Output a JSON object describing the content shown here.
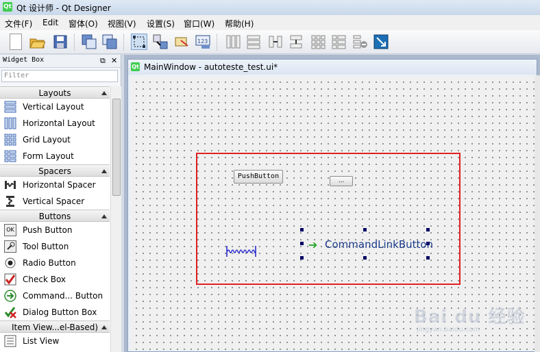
{
  "window": {
    "title": "Qt 设计师 - Qt Designer",
    "logo": "Qt"
  },
  "menu": [
    {
      "label": "文件(F)"
    },
    {
      "label": "Edit"
    },
    {
      "label": "窗体(O)"
    },
    {
      "label": "视图(V)"
    },
    {
      "label": "设置(S)"
    },
    {
      "label": "窗口(W)"
    },
    {
      "label": "帮助(H)"
    }
  ],
  "toolbar": {
    "icons": [
      "new-file-icon",
      "open-folder-icon",
      "save-icon",
      "send-to-back-icon",
      "bring-to-front-icon",
      "edit-widgets-icon",
      "edit-signals-slots-icon",
      "edit-buddies-icon",
      "edit-tab-order-icon",
      "lay-out-horizontally-icon",
      "lay-out-vertically-icon",
      "lay-out-horizontally-splitter-icon",
      "lay-out-vertically-splitter-icon",
      "lay-out-grid-icon",
      "lay-out-form-icon",
      "break-layout-icon",
      "adjust-size-icon"
    ]
  },
  "widget_box": {
    "title": "Widget Box",
    "filter_placeholder": "Filter",
    "categories": [
      {
        "label": "Layouts",
        "items": [
          {
            "label": "Vertical Layout",
            "icon": "vertical-layout-icon"
          },
          {
            "label": "Horizontal Layout",
            "icon": "horizontal-layout-icon"
          },
          {
            "label": "Grid Layout",
            "icon": "grid-layout-icon"
          },
          {
            "label": "Form Layout",
            "icon": "form-layout-icon"
          }
        ]
      },
      {
        "label": "Spacers",
        "items": [
          {
            "label": "Horizontal Spacer",
            "icon": "horizontal-spacer-icon"
          },
          {
            "label": "Vertical Spacer",
            "icon": "vertical-spacer-icon"
          }
        ]
      },
      {
        "label": "Buttons",
        "items": [
          {
            "label": "Push Button",
            "icon": "push-button-icon"
          },
          {
            "label": "Tool Button",
            "icon": "tool-button-icon"
          },
          {
            "label": "Radio Button",
            "icon": "radio-button-icon"
          },
          {
            "label": "Check Box",
            "icon": "check-box-icon"
          },
          {
            "label": "Command... Button",
            "icon": "command-link-button-icon"
          },
          {
            "label": "Dialog Button Box",
            "icon": "dialog-button-box-icon"
          }
        ]
      },
      {
        "label": "Item View...el-Based)",
        "items": [
          {
            "label": "List View",
            "icon": "list-view-icon"
          }
        ]
      }
    ]
  },
  "form": {
    "title": "MainWindow - autoteste_test.ui*",
    "push_button": "PushButton",
    "tool_button": "...",
    "command_link": "CommandLinkButton"
  },
  "watermark": {
    "logo": "Bai du 经验",
    "url": "jingyan.baidu.com"
  },
  "colors": {
    "selection_box": "#e02020",
    "qt_green": "#41cd52"
  }
}
